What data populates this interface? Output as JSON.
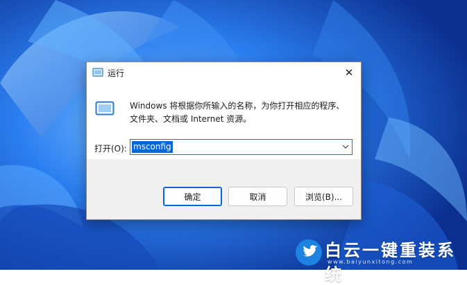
{
  "dialog": {
    "title": "运行",
    "close_label": "✕",
    "description_line1": "Windows 将根据你所输入的名称，为你打开相应的程序、",
    "description_line2": "文件夹、文档或 Internet 资源。",
    "open_label": "打开(O):",
    "input_value": "msconfig",
    "buttons": {
      "ok": "确定",
      "cancel": "取消",
      "browse": "浏览(B)..."
    }
  },
  "watermark": {
    "title": "白云一键重装系统",
    "url": "www.baiyunxitong.com"
  },
  "colors": {
    "accent": "#0a64d6",
    "wallpaper": "#1f63d8"
  }
}
